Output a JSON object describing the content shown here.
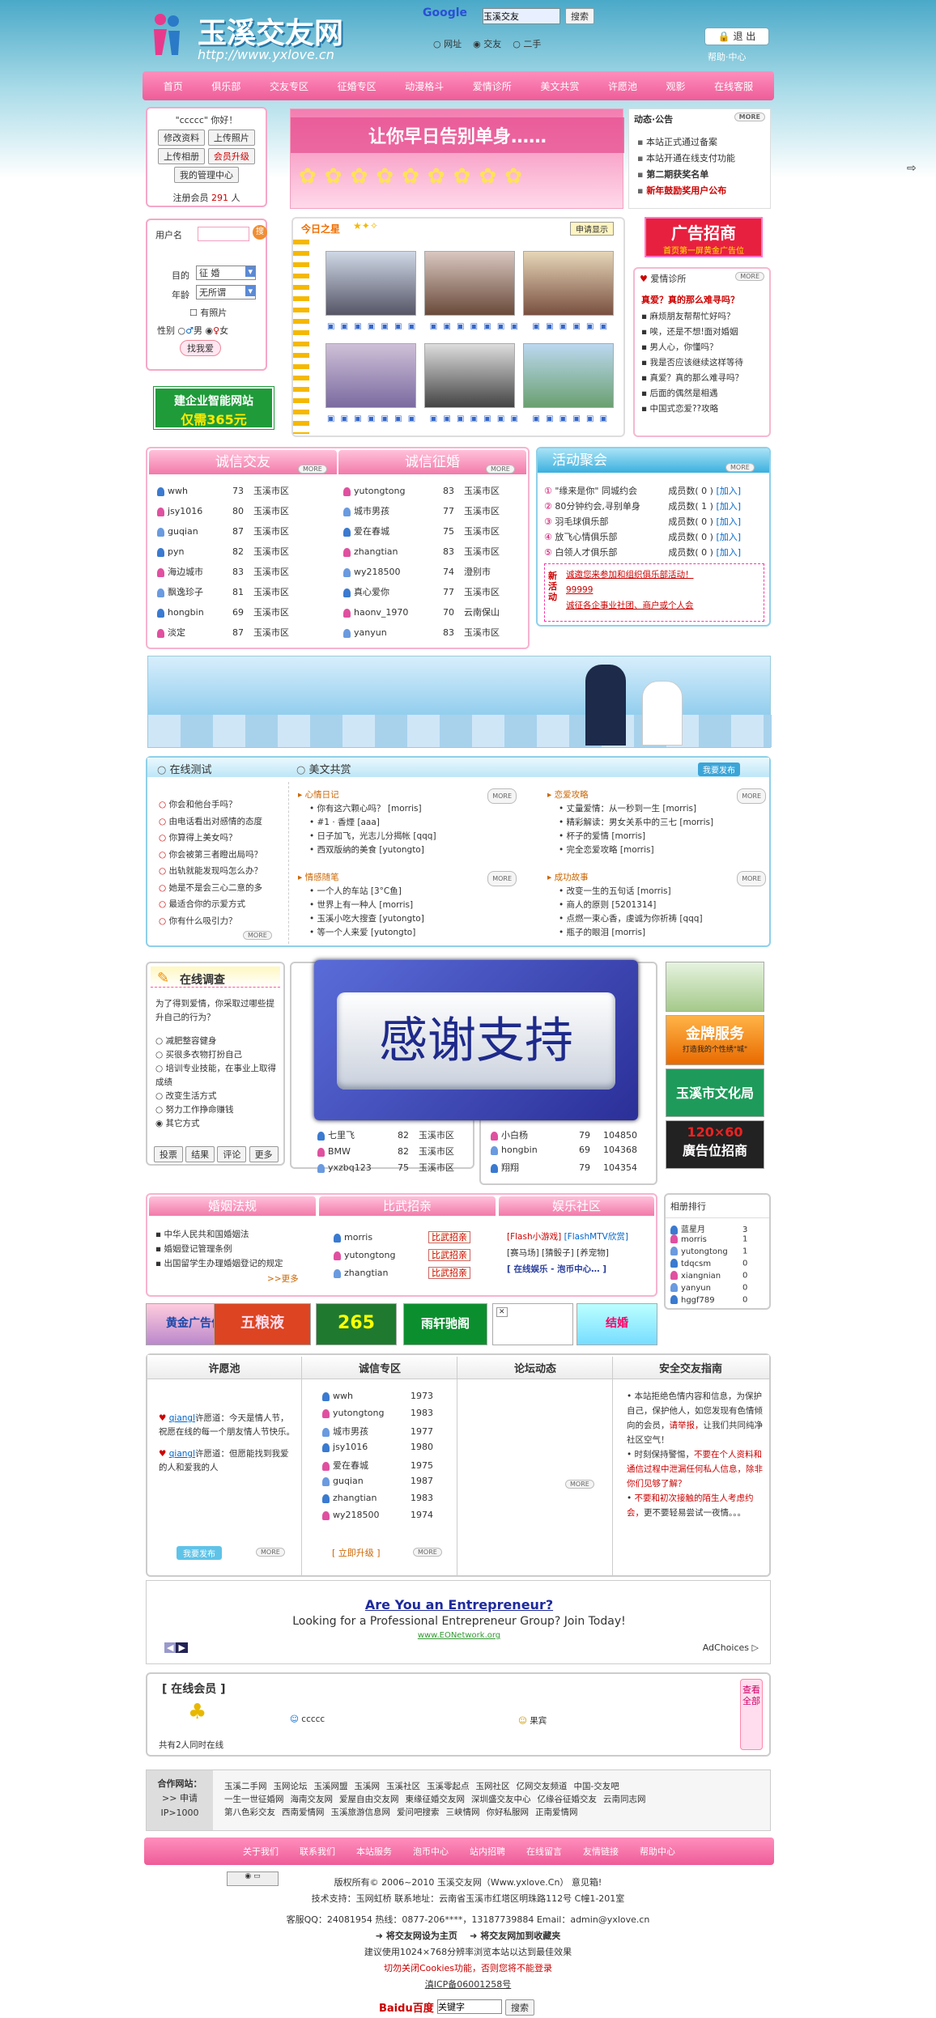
{
  "header": {
    "logo_text": "玉溪交友网",
    "logo_url": "http://www.yxlove.cn",
    "search_brand": "Google",
    "search_value": "玉溪交友",
    "search_button": "搜索",
    "radio_web": "网址",
    "radio_dating": "交友",
    "radio_used": "二手",
    "logout": "退 出",
    "help": "帮助·中心"
  },
  "nav": [
    "首页",
    "俱乐部",
    "交友专区",
    "征婚专区",
    "动漫格斗",
    "爱情诊所",
    "美文共赏",
    "许愿池",
    "观影",
    "在线客服"
  ],
  "user": {
    "greeting": "\"ccccc\" 你好！",
    "buttons": [
      "修改资料",
      "上传照片",
      "上传相册",
      "会员升级",
      "我的管理中心"
    ],
    "registered_label": "注册会员",
    "registered_count": "291",
    "registered_unit": "人"
  },
  "banner_text": "让你早日告别单身……",
  "notice": {
    "title": "动态·公告",
    "more": "MORE",
    "items": [
      "本站正式通过备案",
      "本站开通在线支付功能",
      "第二期获奖名单",
      "新年鼓励奖用户公布"
    ]
  },
  "search_panel": {
    "username_label": "用户名",
    "go": "搜",
    "purpose_label": "目的",
    "purpose_value": "征 婚",
    "age_label": "年龄",
    "age_value": "无所谓",
    "photo": "有照片",
    "gender_label": "性别",
    "male": "男",
    "female": "女",
    "submit": "找我爱"
  },
  "site_ad": {
    "line1": "建企业智能网站",
    "line2": "仅需365元"
  },
  "star": {
    "title": "今日之星",
    "badge": "申请显示"
  },
  "ad_recruit": {
    "line1": "广告招商",
    "line2": "首页第一屏黄金广告位"
  },
  "clinic": {
    "title": "爱情诊所",
    "more": "MORE",
    "headline": "真爱？真的那么难寻吗？",
    "items": [
      "麻烦朋友帮帮忙好吗？",
      "唉，还是不想!面对婚姻",
      "男人心，你懂吗？",
      "我是否应该继续这样等待",
      "真爱？真的那么难寻吗？",
      "后面的偶然是相遇",
      "中国式恋爱??攻略"
    ]
  },
  "cheng_xin": {
    "title": "诚信交友",
    "more": "MORE",
    "rows": [
      {
        "name": "wwh",
        "age": "73",
        "area": "玉溪市区"
      },
      {
        "name": "jsy1016",
        "age": "80",
        "area": "玉溪市区"
      },
      {
        "name": "guqian",
        "age": "87",
        "area": "玉溪市区"
      },
      {
        "name": "pyn",
        "age": "82",
        "area": "玉溪市区"
      },
      {
        "name": "海边城市",
        "age": "83",
        "area": "玉溪市区"
      },
      {
        "name": "飘逸珍子",
        "age": "81",
        "area": "玉溪市区"
      },
      {
        "name": "hongbin",
        "age": "69",
        "area": "玉溪市区"
      },
      {
        "name": "淡定",
        "age": "87",
        "area": "玉溪市区"
      }
    ]
  },
  "zheng_hun": {
    "title": "诚信征婚",
    "more": "MORE",
    "rows": [
      {
        "name": "yutongtong",
        "age": "83",
        "area": "玉溪市区"
      },
      {
        "name": "城市男孩",
        "age": "77",
        "area": "玉溪市区"
      },
      {
        "name": "爱在春城",
        "age": "75",
        "area": "玉溪市区"
      },
      {
        "name": "zhangtian",
        "age": "83",
        "area": "玉溪市区"
      },
      {
        "name": "wy218500",
        "age": "74",
        "area": "澄别市"
      },
      {
        "name": "真心爱你",
        "age": "77",
        "area": "玉溪市区"
      },
      {
        "name": "haonv_1970",
        "age": "70",
        "area": "云南保山"
      },
      {
        "name": "yanyun",
        "age": "83",
        "area": "玉溪市区"
      }
    ]
  },
  "activity": {
    "title": "活动聚会",
    "more": "MORE",
    "rows": [
      {
        "num": "①",
        "name": "\"缘来是你\" 同城约会",
        "label": "成员数",
        "count": "( 0 )",
        "join": "[加入]"
      },
      {
        "num": "②",
        "name": "80分钟约会,寻别单身",
        "label": "成员数",
        "count": "( 1 )",
        "join": "[加入]"
      },
      {
        "num": "③",
        "name": "羽毛球俱乐部",
        "label": "成员数",
        "count": "( 0 )",
        "join": "[加入]"
      },
      {
        "num": "④",
        "name": "放飞心情俱乐部",
        "label": "成员数",
        "count": "( 0 )",
        "join": "[加入]"
      },
      {
        "num": "⑤",
        "name": "白领人才俱乐部",
        "label": "成员数",
        "count": "( 0 )",
        "join": "[加入]"
      }
    ],
    "new_label": "新活动",
    "news": [
      "诚邀您来参加和组织俱乐部活动！",
      "99999",
      "诚征各企事业社团、商户或个人会"
    ]
  },
  "test": {
    "title": "在线测试",
    "items": [
      "你会和他台手吗？",
      "由电话看出对感情的态度",
      "你算得上美女吗？",
      "你会被第三者瞪出局吗？",
      "出轨就能发现吗怎么办？",
      "她是不是会三心二意的多",
      "最适合你的示爱方式",
      "你有什么吸引力？"
    ],
    "more": "MORE"
  },
  "essay": {
    "title": "美文共赏",
    "badge": "我要发布",
    "groups": [
      {
        "title": "心情日记",
        "more": "MORE",
        "items": [
          "你有这六颗心吗？ [morris]",
          "#1 · 香煙 [aaa]",
          "日子加飞，光志儿分揭帐 [qqq]",
          "西双版纳的美食 [yutongto]"
        ]
      },
      {
        "title": "恋爱攻略",
        "more": "MORE",
        "items": [
          "丈量爱情：从一秒到一生 [morris]",
          "精彩解读：男女关系中的三七 [morris]",
          "杯子的爱情 [morris]",
          "完全恋爱攻略 [morris]"
        ]
      },
      {
        "title": "情感随笔",
        "more": "MORE",
        "items": [
          "一个人的车站 [3°C鱼]",
          "世界上有一种人 [morris]",
          "玉溪小吃大搜查 [yutongto]",
          "等一个人来爱 [yutongto]"
        ]
      },
      {
        "title": "成功故事",
        "more": "MORE",
        "items": [
          "改变一生的五句话 [morris]",
          "商人的原则 [5201314]",
          "点燃一束心香，虔诚为你祈祷 [qqq]",
          "瓶子的眼泪 [morris]"
        ]
      }
    ]
  },
  "survey": {
    "title": "在线调查",
    "question": "为了得到爱情，你采取过哪些提升自己的行为？",
    "options": [
      "减肥整容健身",
      "买很多衣物打扮自己",
      "培训专业技能，在事业上取得成绩",
      "改变生活方式",
      "努力工作挣命赚钱",
      "其它方式"
    ],
    "buttons": [
      "投票",
      "结果",
      "评论",
      "更多"
    ]
  },
  "overlay": {
    "text": "感谢支持"
  },
  "mid_list": {
    "rows": [
      {
        "name": "七里飞",
        "age": "82",
        "area": "玉溪市区"
      },
      {
        "name": "BMW",
        "age": "82",
        "area": "玉溪市区"
      },
      {
        "name": "yxzbq123",
        "age": "75",
        "area": "玉溪市区"
      }
    ]
  },
  "rank_list": {
    "rows": [
      {
        "name": "小白杨",
        "age": "79",
        "value": "104850"
      },
      {
        "name": "hongbin",
        "age": "69",
        "value": "104368"
      },
      {
        "name": "翔翔",
        "age": "79",
        "value": "104354"
      }
    ]
  },
  "right_ads": {
    "gold_line1": "金牌服务",
    "gold_line2": "打造我的个性绣\"城\"",
    "culture": "玉溪市文化局",
    "size": "120×60",
    "ad_recruit": "廣告位招商"
  },
  "law": {
    "title": "婚姻法规",
    "items": [
      "中华人民共和国婚姻法",
      "婚姻登记管理条例",
      "出国留学生办理婚姻登记的规定"
    ],
    "more": ">>更多"
  },
  "contest": {
    "title": "比武招亲",
    "rows": [
      {
        "name": "morris",
        "action": "比武招亲"
      },
      {
        "name": "yutongtong",
        "action": "比武招亲"
      },
      {
        "name": "zhangtian",
        "action": "比武招亲"
      }
    ]
  },
  "ent": {
    "title": "娱乐社区",
    "links": [
      "[Flash小游戏]",
      "[FlashMTV欣赏]",
      "[赛马场]",
      "[猜骰子]",
      "[养宠物]"
    ],
    "footer": "[ 在线娱乐 - 泡币中心… ]"
  },
  "photo_rank": {
    "title": "相册排行",
    "rows": [
      {
        "name": "蓝星月",
        "n": "3"
      },
      {
        "name": "morris",
        "n": "1"
      },
      {
        "name": "yutongtong",
        "n": "1"
      },
      {
        "name": "tdqcsm",
        "n": "0"
      },
      {
        "name": "xiangnian",
        "n": "0"
      },
      {
        "name": "yanyun",
        "n": "0"
      },
      {
        "name": "hggf789",
        "n": "0"
      }
    ]
  },
  "ad_strip": [
    "黄金广告位",
    "五粮液",
    "265",
    "雨轩驰阁",
    "",
    "结婚"
  ],
  "wish": {
    "title": "许愿池",
    "entries": [
      {
        "user": "qiangl",
        "text": "许愿道：今天是情人节，祝愿在线的每一个朋友情人节快乐。"
      },
      {
        "user": "qiangl",
        "text": "许愿道：但愿能找到我爱的人和爱我的人"
      }
    ],
    "publish": "我要发布",
    "more": "MORE"
  },
  "credit": {
    "title": "诚信专区",
    "rows": [
      {
        "name": "wwh",
        "year": "1973"
      },
      {
        "name": "yutongtong",
        "year": "1983"
      },
      {
        "name": "城市男孩",
        "year": "1977"
      },
      {
        "name": "jsy1016",
        "year": "1980"
      },
      {
        "name": "爱在春城",
        "year": "1975"
      },
      {
        "name": "guqian",
        "year": "1987"
      },
      {
        "name": "zhangtian",
        "year": "1983"
      },
      {
        "name": "wy218500",
        "year": "1974"
      }
    ],
    "upgrade": "[ 立即升级 ]",
    "more": "MORE"
  },
  "forum": {
    "title": "论坛动态",
    "more": "MORE"
  },
  "safety": {
    "title": "安全交友指南",
    "p1a": "本站拒绝色情内容和信息，为保护自己，保护他人，如您发现有色情倾向的会员，",
    "p1b": "请举报，",
    "p1c": "让我们共同纯净社区空气！",
    "p2a": "时刻保持警惕，",
    "p2b": "不要在个人资料和通信过程中泄漏任何私人信息，除非你们见够了解？",
    "p3a": "不要和初次接触的陌生人考",
    "p3b": "虑约会，",
    "p3c": "更不要轻易尝试一夜情。。。"
  },
  "google_ad": {
    "title": "Are You an Entrepreneur?",
    "text": "Looking for a Professional Entrepreneur Group? Join Today!",
    "url": "www.EONetwork.org",
    "choices": "AdChoices"
  },
  "online": {
    "title": "在线会员",
    "count_text": "共有2人同时在线",
    "member1": "ccccc",
    "member2": "果宾",
    "side": "查看全部"
  },
  "partners": {
    "title": "合作网站：",
    "apply": ">> 申请",
    "ip": "IP>1000",
    "row1": [
      "玉溪二手网",
      "玉网论坛",
      "玉溪网盟",
      "玉溪网",
      "玉溪社区",
      "玉溪零起点",
      "玉网社区",
      "亿网交友频道",
      "中国-交友吧"
    ],
    "row2": [
      "一生一世征婚网",
      "海南交友网",
      "爱屋自由交友网",
      "東缘征婚交友网",
      "深圳盛交友中心",
      "亿缘谷征婚交友",
      "云南同志网"
    ],
    "row3": [
      "第八色彩交友",
      "西南爱情网",
      "玉溪旅游信息网",
      "爱问吧搜索",
      "三峡情网",
      "你好私服网",
      "正南爱情网"
    ]
  },
  "footer_nav": [
    "关于我们",
    "联系我们",
    "本站服务",
    "泡币中心",
    "站内招聘",
    "在线留言",
    "友情链接",
    "帮助中心"
  ],
  "footer": {
    "copyright": "版权所有© 2006~2010 玉溪交友网（Www.yxlove.Cn） 意见箱!",
    "tech": "技术支持：玉网虹桥 联系地址：云南省玉溪市红塔区明珠路112号 C幢1-201室",
    "contact": "客服QQ：24081954 热线：0877-206****，13187739884 Email：admin@yxlove.cn",
    "home": "将交友网设为主页",
    "fav": "将交友网加到收藏夹",
    "advice": "建议使用1024×768分辨率浏览本站以达到最佳效果",
    "cookie": "切勿关闭Cookies功能，否则您将不能登录",
    "icp": "滇ICP备06001258号",
    "baidu": "Baidu百度",
    "baidu_value": "关键字",
    "baidu_btn": "搜索"
  }
}
